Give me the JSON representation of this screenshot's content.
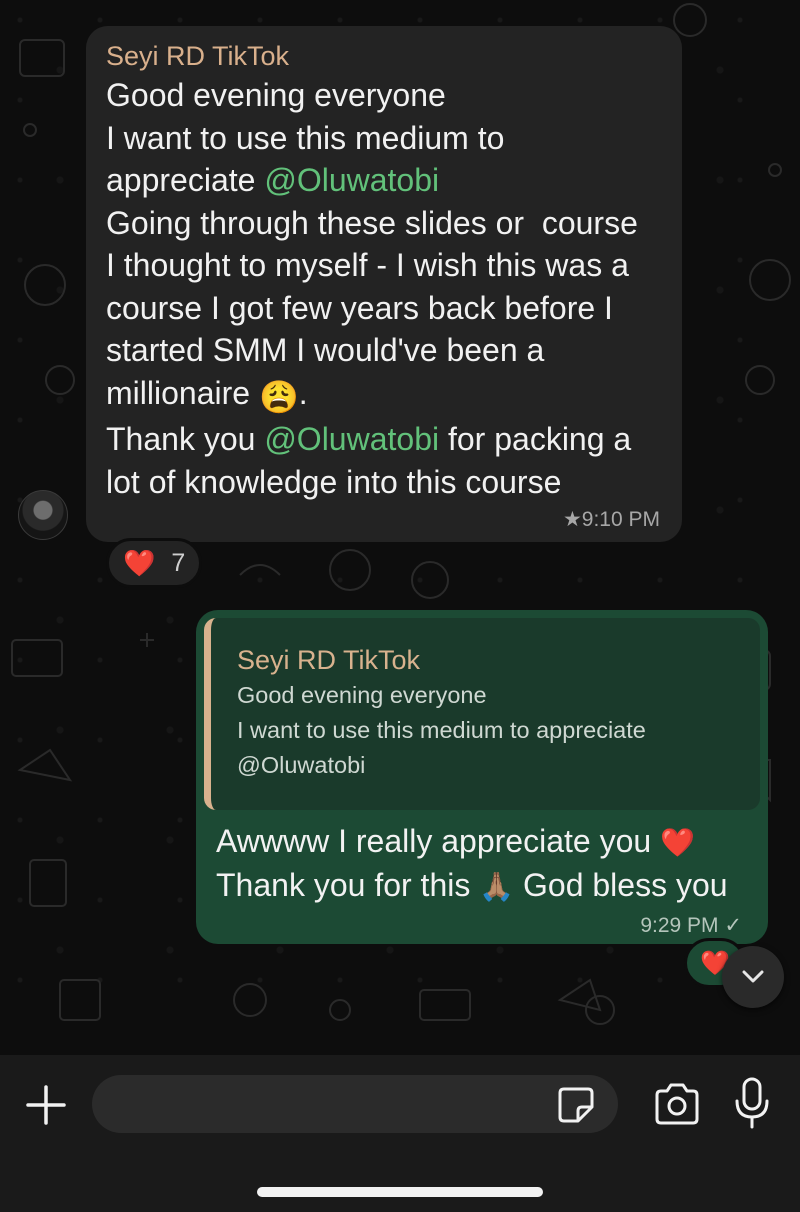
{
  "incoming_message": {
    "sender": "Seyi RD TikTok",
    "lines": [
      {
        "text": "Good evening everyone"
      },
      {
        "text": "I want to use this medium to"
      },
      {
        "before": "appreciate ",
        "mention": "@Oluwatobi",
        "after": ""
      },
      {
        "text": "Going through these slides or  course"
      },
      {
        "text": "I thought to myself - I wish this was a"
      },
      {
        "text": "course I got few years back before I"
      },
      {
        "text": "started SMM I would've been a"
      },
      {
        "before": "millionaire ",
        "emoji": "😩",
        "after": "."
      },
      {
        "before": "Thank you ",
        "mention": "@Oluwatobi",
        "after": " for packing a"
      },
      {
        "text": "lot of knowledge into this course"
      }
    ],
    "star": "★",
    "time": "9:10 PM",
    "reaction": {
      "emoji": "❤️",
      "count": "7"
    }
  },
  "outgoing_message": {
    "quote": {
      "sender": "Seyi RD TikTok",
      "line1": "Good evening everyone",
      "line2": "I want to use this medium to appreciate",
      "line3": "@Oluwatobi"
    },
    "line1": {
      "text": "Awwww I really appreciate you ",
      "emoji": "❤️"
    },
    "line2": {
      "before": "Thank you for this ",
      "emoji": "🙏🏽",
      "after": " God bless you"
    },
    "time": "9:29 PM",
    "tick": "✓",
    "reaction": {
      "emoji": "❤️"
    }
  },
  "input_bar": {
    "placeholder": ""
  },
  "icons": [
    "plus-icon",
    "sticker-icon",
    "camera-icon",
    "microphone-icon",
    "chevron-down-icon"
  ],
  "colors": {
    "background": "#0d0d0d",
    "incoming_bubble": "#232323",
    "outgoing_bubble": "#1c4a34",
    "sender_name": "#d9b08c",
    "mention": "#62c17a"
  }
}
